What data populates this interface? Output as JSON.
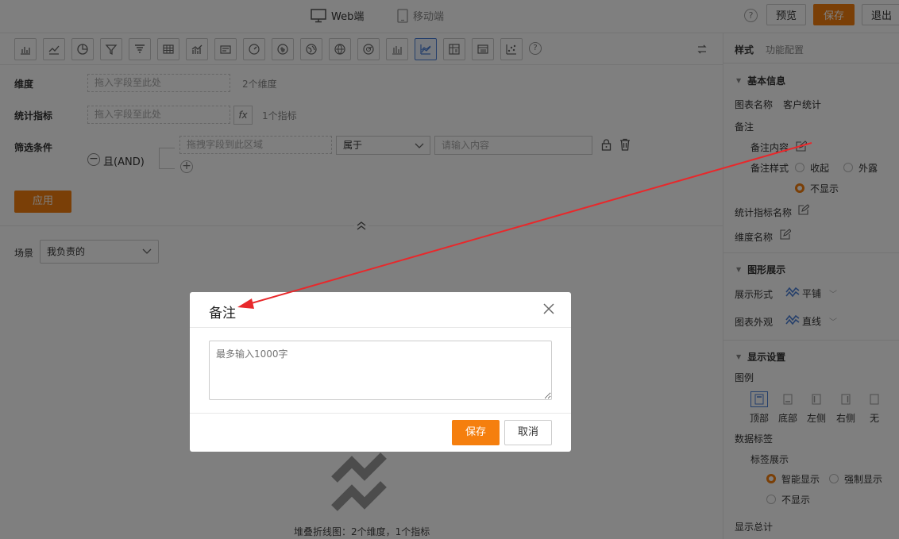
{
  "topbar": {
    "web_label": "Web端",
    "mobile_label": "移动端",
    "help": "?",
    "preview_label": "预览",
    "save_label": "保存",
    "exit_label": "退出"
  },
  "chart_types": [
    {
      "name": "bar-chart-icon",
      "active": false
    },
    {
      "name": "line-chart-icon",
      "active": false
    },
    {
      "name": "pie-chart-icon",
      "active": false
    },
    {
      "name": "funnel-icon",
      "active": false
    },
    {
      "name": "funnel-alt-icon",
      "active": false
    },
    {
      "name": "table-icon",
      "active": false
    },
    {
      "name": "bar-line-combo-icon",
      "active": false
    },
    {
      "name": "card-icon",
      "active": false
    },
    {
      "name": "gauge-icon",
      "active": false
    },
    {
      "name": "map-icon",
      "active": false
    },
    {
      "name": "globe-map-icon",
      "active": false
    },
    {
      "name": "world-map-icon",
      "active": false
    },
    {
      "name": "radar-icon",
      "active": false
    },
    {
      "name": "column-chart-icon",
      "active": false
    },
    {
      "name": "stacked-line-icon",
      "active": true
    },
    {
      "name": "pivot-table-icon",
      "active": false
    },
    {
      "name": "detail-table-icon",
      "active": false
    },
    {
      "name": "scatter-icon",
      "active": false
    }
  ],
  "query": {
    "dimension_label": "维度",
    "dimension_placeholder": "拖入字段至此处",
    "dimension_hint": "2个维度",
    "metric_label": "统计指标",
    "metric_placeholder": "拖入字段至此处",
    "metric_fx": "fx",
    "metric_hint": "1个指标",
    "filter_label": "筛选条件",
    "and_minus": "−",
    "and_label": "且(AND)",
    "filter_field_placeholder": "拖拽字段到此区域",
    "filter_operator": "属于",
    "filter_value_placeholder": "请输入内容",
    "filter_add": "+",
    "apply_label": "应用",
    "scene_label": "场景",
    "scene_value": "我负责的"
  },
  "chart_caption": "堆叠折线图：2个维度，1个指标",
  "right_panel": {
    "tab_style": "样式",
    "tab_function": "功能配置",
    "more": "⋮",
    "basic_section": "基本信息",
    "chart_name_label": "图表名称",
    "chart_name_value": "客户统计",
    "remark_label": "备注",
    "remark_content_label": "备注内容",
    "remark_style_label": "备注样式",
    "remark_style_options": [
      "收起",
      "外露",
      "不显示"
    ],
    "remark_style_selected": "不显示",
    "metric_name_label": "统计指标名称",
    "dimension_name_label": "维度名称",
    "display_section": "图形展示",
    "display_form_label": "展示形式",
    "display_form_value": "平铺",
    "appearance_label": "图表外观",
    "appearance_value": "直线",
    "show_section": "显示设置",
    "legend_label": "图例",
    "legend_options": [
      "顶部",
      "底部",
      "左侧",
      "右侧",
      "无"
    ],
    "legend_selected": "顶部",
    "data_label_label": "数据标签",
    "label_display_label": "标签展示",
    "label_display_options": [
      "智能显示",
      "强制显示",
      "不显示"
    ],
    "label_display_selected": "智能显示",
    "total_label": "显示总计"
  },
  "modal": {
    "title": "备注",
    "placeholder": "最多输入1000字",
    "save_label": "保存",
    "cancel_label": "取消"
  },
  "colors": {
    "accent": "#f57f0e",
    "active_blue": "#4a7fd6",
    "annotation_red": "#e8282b"
  }
}
